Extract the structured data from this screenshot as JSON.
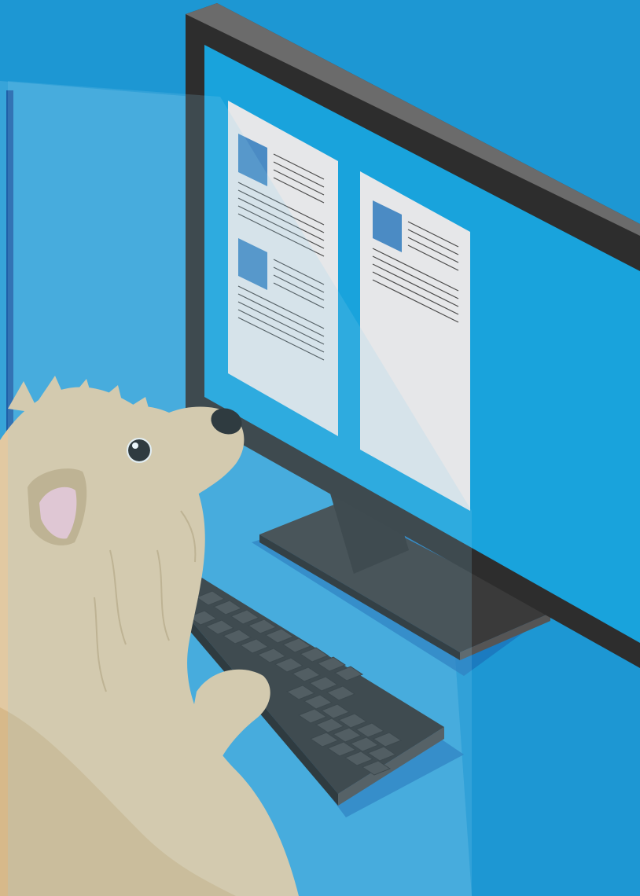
{
  "scene": {
    "subject": "dog-at-computer",
    "colors": {
      "background": "#1d97d3",
      "background_shadow": "#1b7fc4",
      "panel_edge": "#1f5fa8",
      "monitor_bezel": "#2d2d2d",
      "monitor_bezel_light": "#5a5a5a",
      "screen": "#19a3dc",
      "document_page": "#e6e7e9",
      "document_thumbnail": "#4b8bc4",
      "document_line": "#4a4a4a",
      "keyboard": "#2e2e2e",
      "key": "#404040",
      "dog_fur": "#e2c9a2",
      "dog_fur_dark": "#c9ad80",
      "ear_inner": "#f1c5cf",
      "nose": "#1a1a1a"
    },
    "icons": [
      "monitor-icon",
      "keyboard-icon",
      "document-icon",
      "dog-icon"
    ],
    "documents_on_screen": 2
  }
}
